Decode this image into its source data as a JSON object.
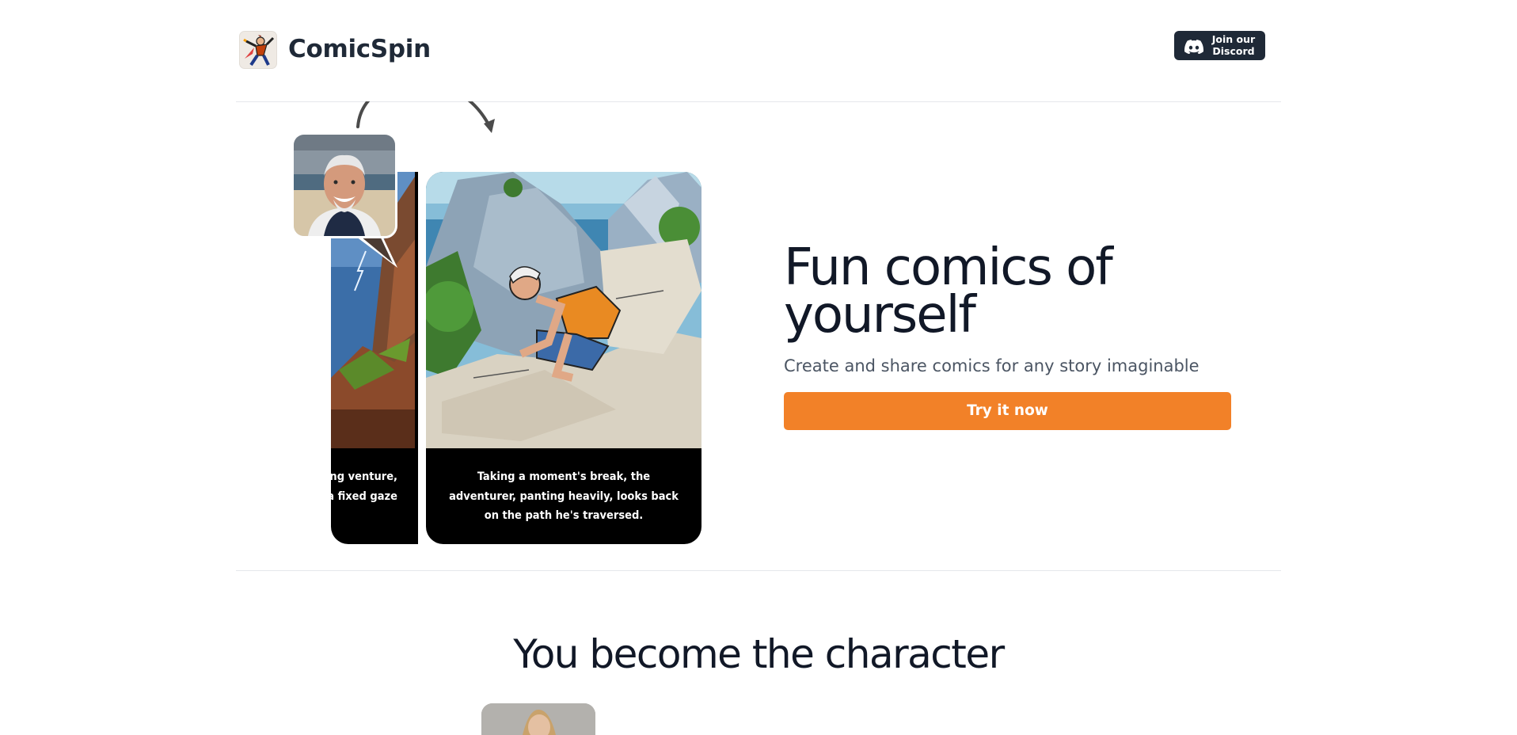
{
  "header": {
    "brand": "ComicSpin",
    "logo_icon": "comic-hero-logo-icon",
    "discord_line1": "Join our",
    "discord_line2": "Discord",
    "discord_icon": "discord-icon"
  },
  "hero": {
    "title_line1": "Fun comics of",
    "title_line2": "yourself",
    "subtitle": "Create and share comics for any story imaginable",
    "cta_label": "Try it now",
    "panel_main_caption": "Taking a moment's break, the adventurer, panting heavily, looks back on the path he's traversed.",
    "panel_left_caption_line1": "ng venture,",
    "panel_left_caption_line2": "n a fixed gaze"
  },
  "section2": {
    "title": "You become the character"
  },
  "colors": {
    "accent": "#f28128",
    "dark": "#1f2937",
    "text": "#111827",
    "muted": "#4b5563"
  }
}
